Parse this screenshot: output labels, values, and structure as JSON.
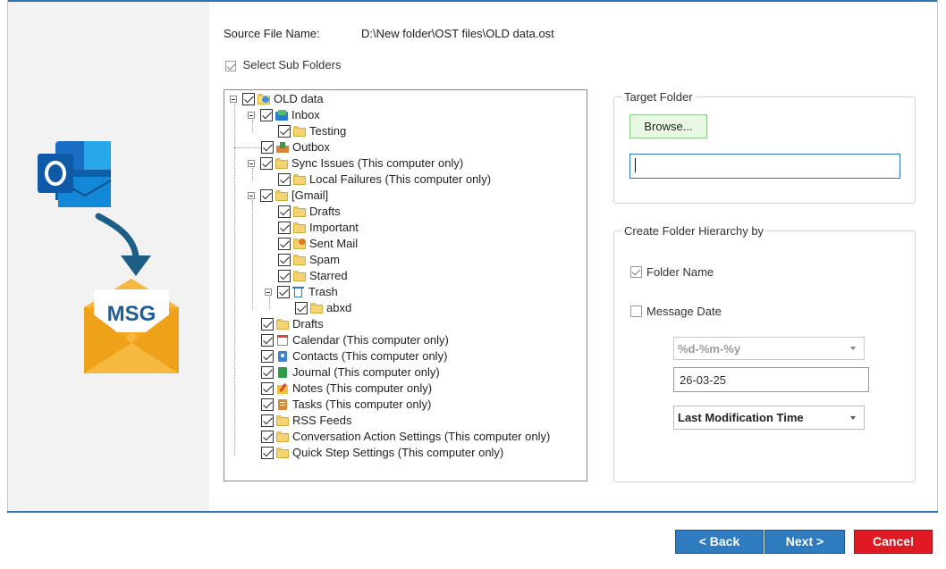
{
  "source": {
    "label": "Source File Name:",
    "value": "D:\\New folder\\OST files\\OLD data.ost"
  },
  "select_sub_folders": {
    "label": "Select Sub Folders",
    "checked": true
  },
  "sidebar": {
    "logo_text": "MSG"
  },
  "tree": {
    "root": "OLD data",
    "items": [
      {
        "label": "Inbox",
        "icon": "inbox-icon"
      },
      {
        "label": "Testing",
        "icon": "folder-icon"
      },
      {
        "label": "Outbox",
        "icon": "outbox-icon"
      },
      {
        "label": "Sync Issues (This computer only)",
        "icon": "folder-icon"
      },
      {
        "label": "Local Failures (This computer only)",
        "icon": "folder-icon"
      },
      {
        "label": "[Gmail]",
        "icon": "folder-icon"
      },
      {
        "label": "Drafts",
        "icon": "folder-icon"
      },
      {
        "label": "Important",
        "icon": "folder-icon"
      },
      {
        "label": "Sent Mail",
        "icon": "sent-mail-icon"
      },
      {
        "label": "Spam",
        "icon": "folder-icon"
      },
      {
        "label": "Starred",
        "icon": "folder-icon"
      },
      {
        "label": "Trash",
        "icon": "trash-icon"
      },
      {
        "label": "abxd",
        "icon": "folder-icon"
      },
      {
        "label": "Drafts",
        "icon": "folder-icon"
      },
      {
        "label": "Calendar (This computer only)",
        "icon": "calendar-icon"
      },
      {
        "label": "Contacts (This computer only)",
        "icon": "contacts-icon"
      },
      {
        "label": "Journal (This computer only)",
        "icon": "journal-icon"
      },
      {
        "label": "Notes (This computer only)",
        "icon": "notes-icon"
      },
      {
        "label": "Tasks (This computer only)",
        "icon": "tasks-icon"
      },
      {
        "label": "RSS Feeds",
        "icon": "folder-icon"
      },
      {
        "label": "Conversation Action Settings (This computer only)",
        "icon": "folder-icon"
      },
      {
        "label": "Quick Step Settings (This computer only)",
        "icon": "folder-icon"
      }
    ]
  },
  "target_folder": {
    "legend": "Target Folder",
    "browse_label": "Browse...",
    "path_value": ""
  },
  "hierarchy": {
    "legend": "Create Folder Hierarchy by",
    "folder_name": {
      "label": "Folder Name",
      "checked": true
    },
    "message_date": {
      "label": "Message Date",
      "checked": false
    },
    "date_format": "%d-%m-%y",
    "date_preview": "26-03-25",
    "time_basis": "Last Modification Time"
  },
  "footer": {
    "back_label": "< Back",
    "next_label": "Next >",
    "cancel_label": "Cancel"
  }
}
